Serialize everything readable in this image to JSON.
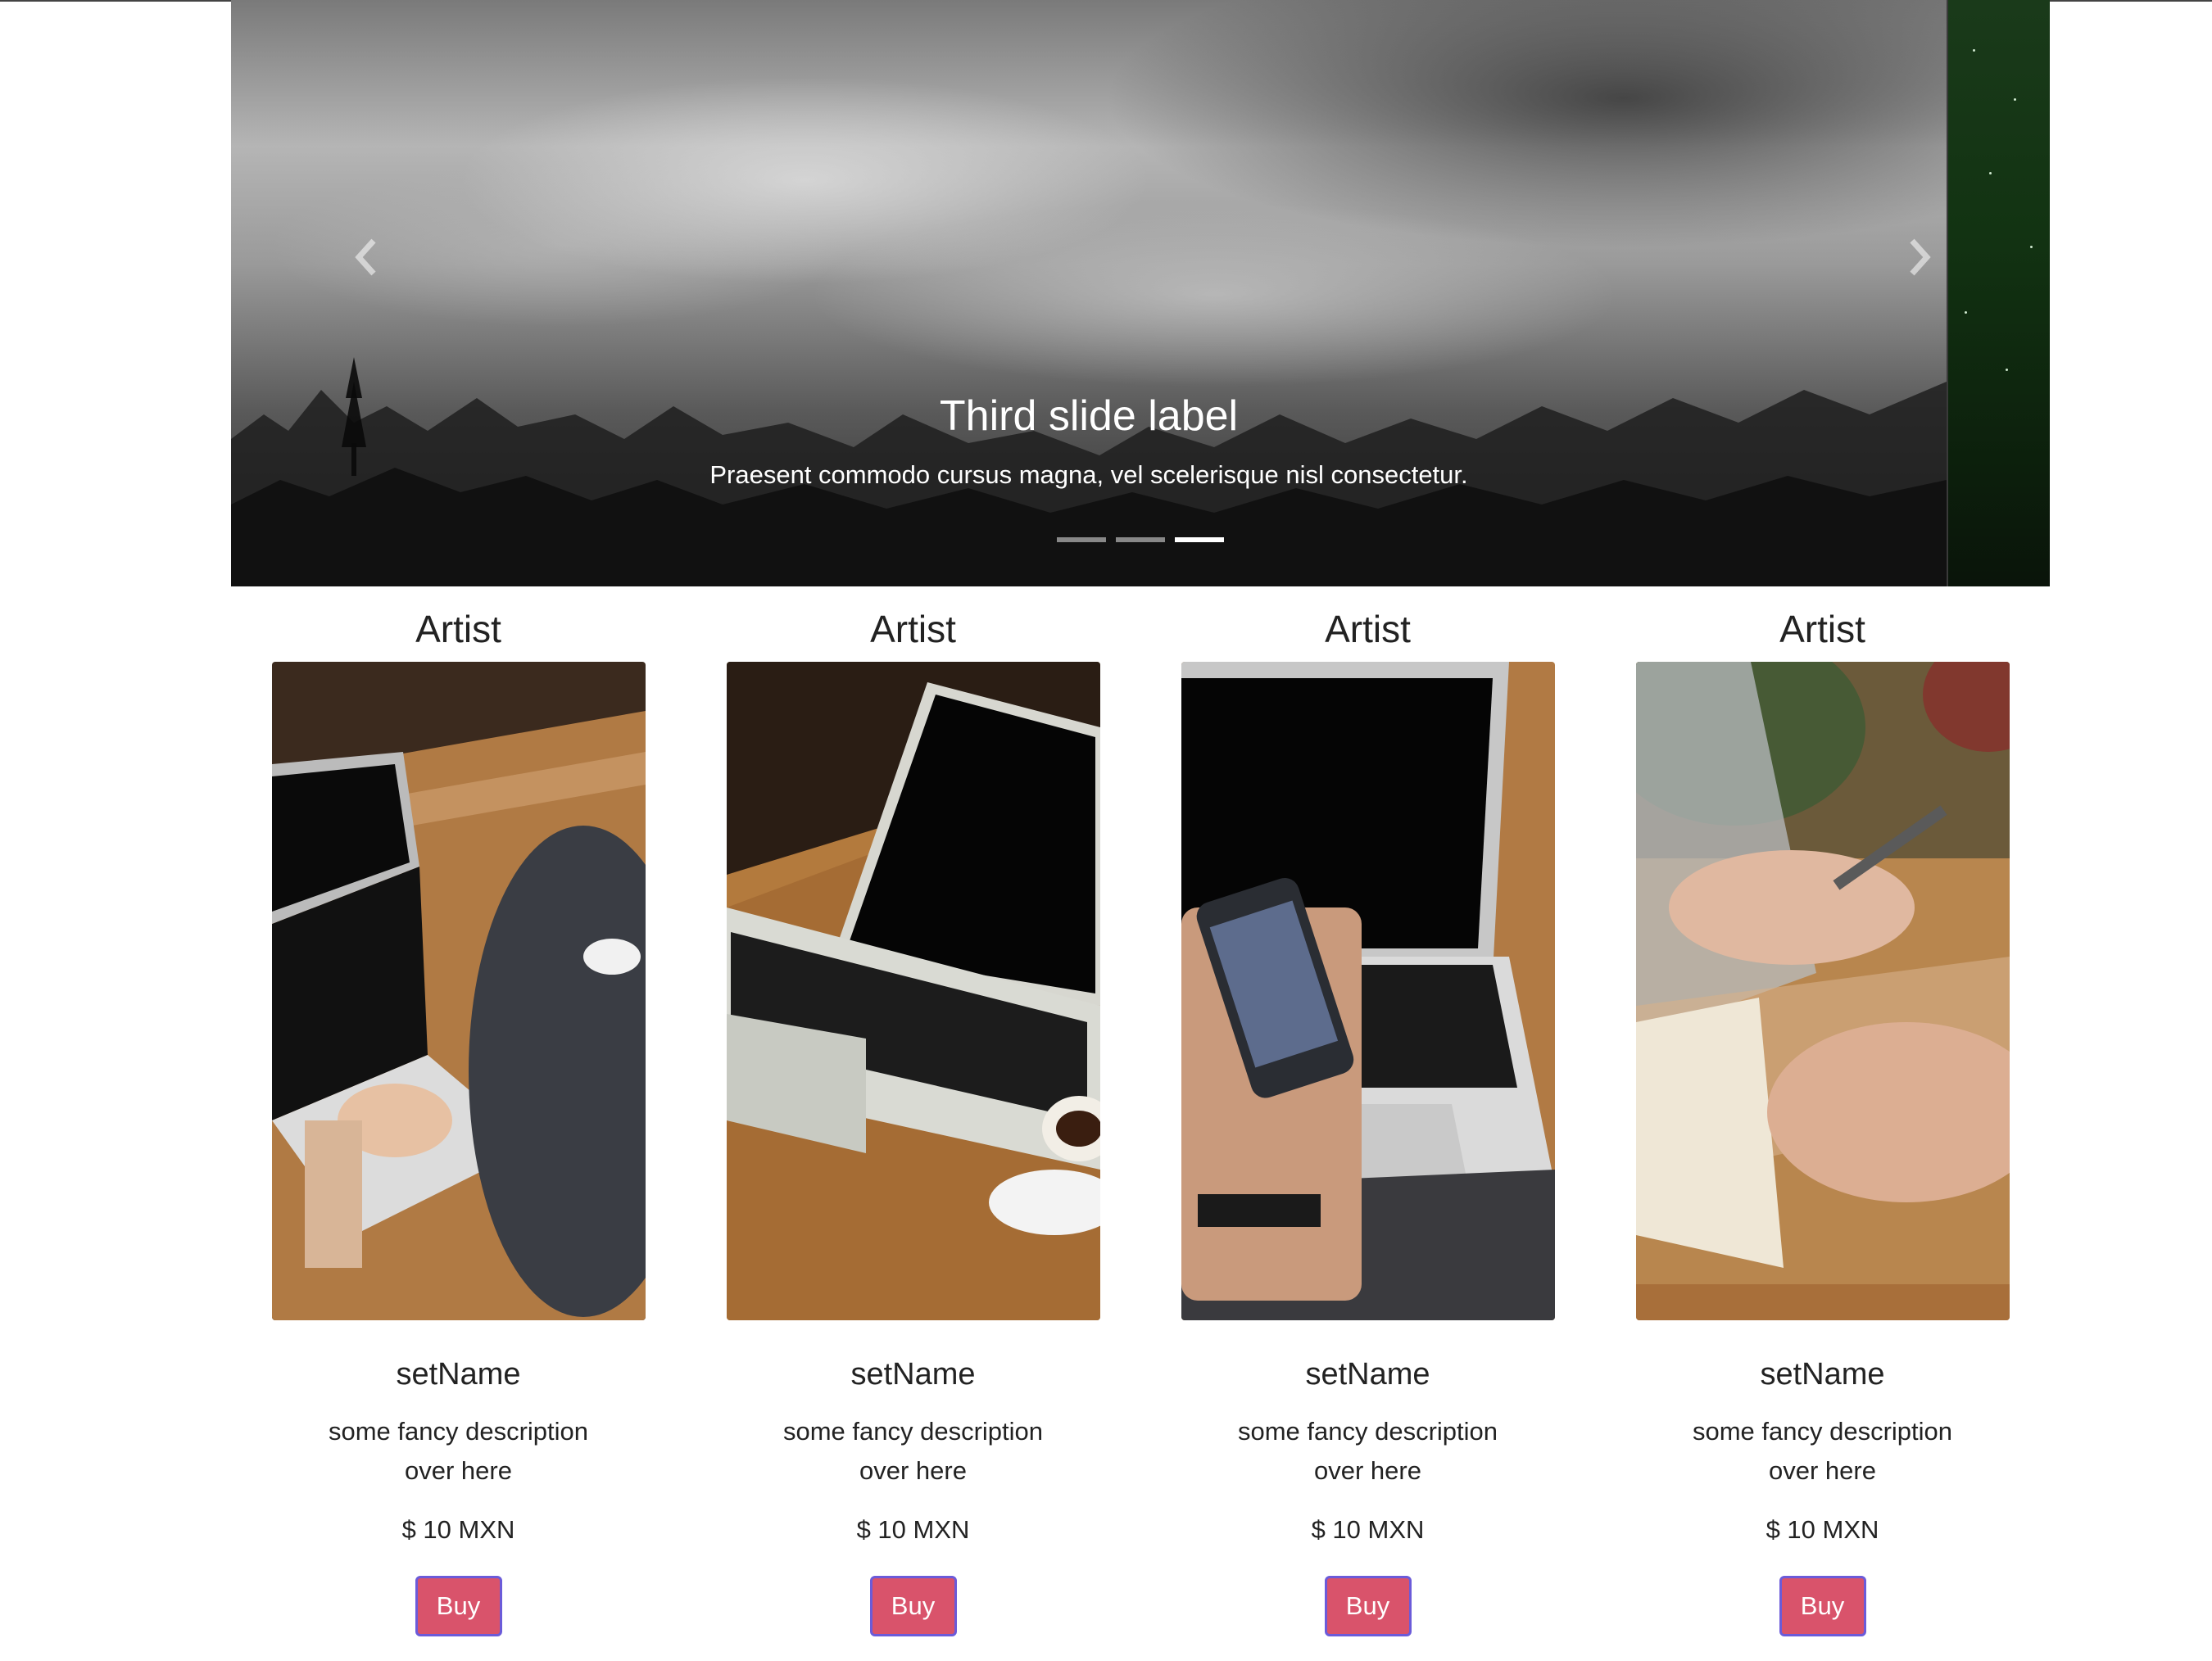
{
  "carousel": {
    "caption_title": "Third slide label",
    "caption_text": "Praesent commodo cursus magna, vel scelerisque nisl consectetur.",
    "slide_count": 3,
    "active_index": 2,
    "prev_icon": "chevron-left-icon",
    "next_icon": "chevron-right-icon"
  },
  "products": [
    {
      "artist": "Artist",
      "set_name": "setName",
      "description": "some fancy description over here",
      "price": "$ 10 MXN",
      "buy_label": "Buy",
      "photo": "laptop-typing-photo"
    },
    {
      "artist": "Artist",
      "set_name": "setName",
      "description": "some fancy description over here",
      "price": "$ 10 MXN",
      "buy_label": "Buy",
      "photo": "laptop-coffee-photo"
    },
    {
      "artist": "Artist",
      "set_name": "setName",
      "description": "some fancy description over here",
      "price": "$ 10 MXN",
      "buy_label": "Buy",
      "photo": "phone-laptop-photo"
    },
    {
      "artist": "Artist",
      "set_name": "setName",
      "description": "some fancy description over here",
      "price": "$ 10 MXN",
      "buy_label": "Buy",
      "photo": "notebook-writing-photo"
    }
  ],
  "colors": {
    "buy_button": "#d9536b",
    "buy_border": "#6b5bd9",
    "text": "#222222"
  }
}
